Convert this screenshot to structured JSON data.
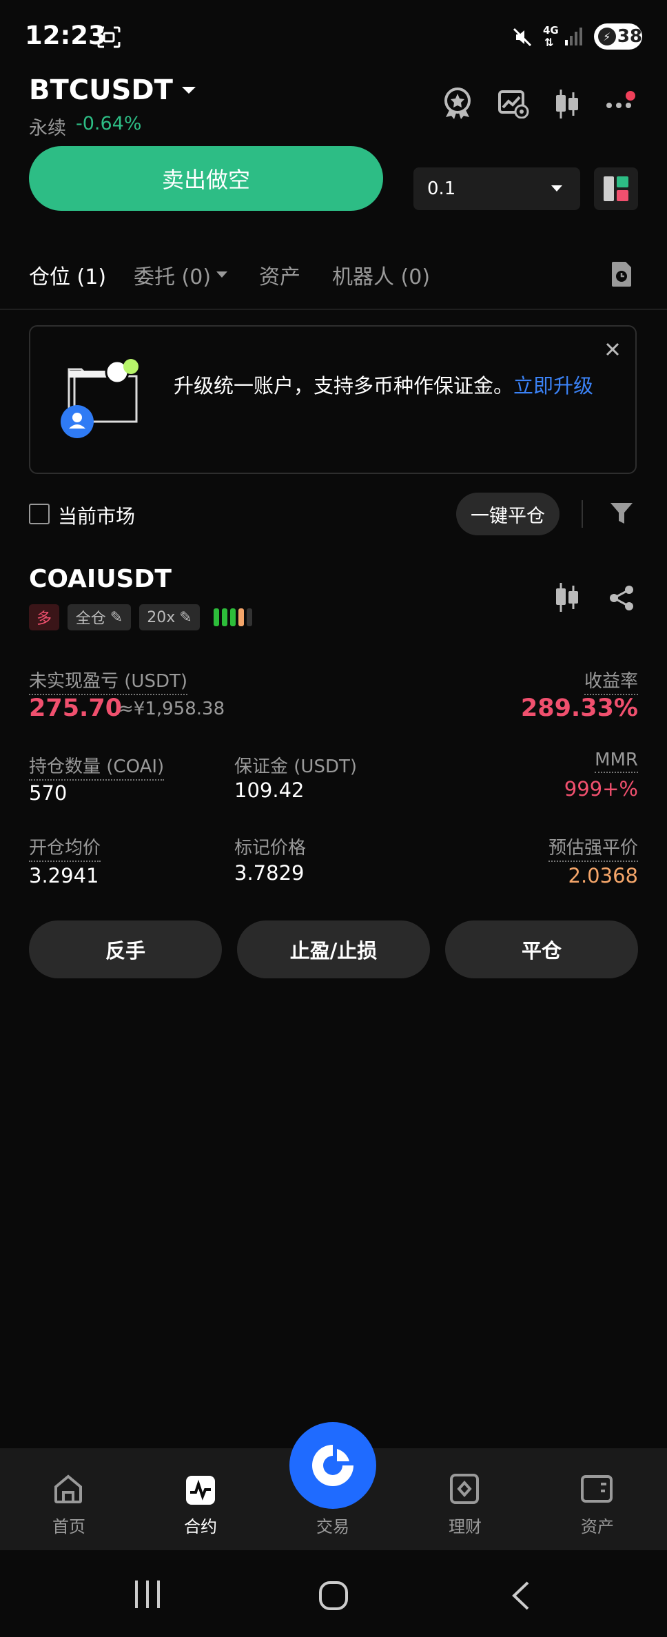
{
  "status_bar": {
    "time": "12:23",
    "network": "4G",
    "battery": "38"
  },
  "header": {
    "symbol": "BTCUSDT",
    "contract_type": "永续",
    "change": "-0.64%"
  },
  "trade": {
    "sell_button": "卖出做空",
    "quantity_value": "0.1"
  },
  "tabs": [
    {
      "label": "仓位 (1)"
    },
    {
      "label": "委托 (0)"
    },
    {
      "label": "资产"
    },
    {
      "label": "机器人 (0)"
    }
  ],
  "banner": {
    "text": "升级统一账户，支持多币种作保证金。",
    "link": "立即升级"
  },
  "filter": {
    "current_market": "当前市场",
    "close_all": "一键平仓"
  },
  "position": {
    "symbol": "COAIUSDT",
    "side": "多",
    "margin_mode": "全仓",
    "leverage": "20x",
    "unrealized_pnl_label": "未实现盈亏 (USDT)",
    "unrealized_pnl": "275.70",
    "unrealized_pnl_cny": "≈¥1,958.38",
    "roi_label": "收益率",
    "roi": "289.33%",
    "qty_label": "持仓数量 (COAI)",
    "qty": "570",
    "margin_label": "保证金 (USDT)",
    "margin": "109.42",
    "mmr_label": "MMR",
    "mmr": "999+%",
    "entry_label": "开仓均价",
    "entry": "3.2941",
    "mark_label": "标记价格",
    "mark": "3.7829",
    "liq_label": "预估强平价",
    "liq": "2.0368",
    "btn_reverse": "反手",
    "btn_tpsl": "止盈/止损",
    "btn_close": "平仓"
  },
  "bottom_nav": [
    {
      "label": "首页"
    },
    {
      "label": "合约"
    },
    {
      "label": "交易"
    },
    {
      "label": "理财"
    },
    {
      "label": "资产"
    }
  ],
  "colors": {
    "accent_green": "#2dbd85",
    "accent_red": "#f0506e",
    "link_blue": "#3b82f6",
    "fab_blue": "#1f6bff"
  }
}
